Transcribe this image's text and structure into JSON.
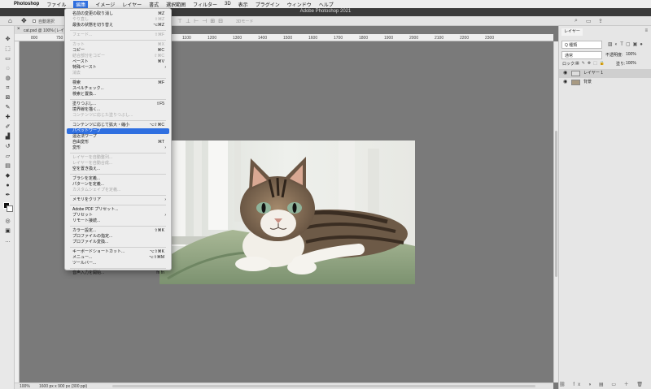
{
  "menubar": {
    "apple": "",
    "app": "Photoshop",
    "items": [
      "ファイル",
      "編集",
      "イメージ",
      "レイヤー",
      "書式",
      "選択範囲",
      "フィルター",
      "3D",
      "表示",
      "プラグイン",
      "ウィンドウ",
      "ヘルプ"
    ],
    "active_index": 1
  },
  "window": {
    "title": "Adobe Photoshop 2021"
  },
  "options": {
    "autoselect_label": "自動選択",
    "mode3d": "3Dモード"
  },
  "document": {
    "tab_label": "cat.psd @ 100% (レイヤー",
    "zoom": "100%",
    "info": "1600 px x 900 px (300 ppi)"
  },
  "ruler": {
    "ticks": [
      "800",
      "750",
      "700",
      "650",
      "900",
      "1000",
      "1100",
      "1200",
      "1300",
      "1400",
      "1500",
      "1600",
      "1700",
      "1800",
      "1900",
      "2000",
      "2100",
      "2200",
      "2300"
    ]
  },
  "edit_menu": {
    "items": [
      {
        "label": "名前の変更の取り消し",
        "shortcut": "⌘Z",
        "disabled": false
      },
      {
        "label": "やり直し",
        "shortcut": "⇧⌘Z",
        "disabled": true
      },
      {
        "label": "最後の状態を切り替え",
        "shortcut": "⌥⌘Z",
        "disabled": false
      },
      {
        "label": "フェード...",
        "shortcut": "⇧⌘F",
        "disabled": true
      },
      {
        "label": "カット",
        "shortcut": "⌘X",
        "disabled": true
      },
      {
        "label": "コピー",
        "shortcut": "⌘C",
        "disabled": false
      },
      {
        "label": "結合部分をコピー",
        "shortcut": "⇧⌘C",
        "disabled": true
      },
      {
        "label": "ペースト",
        "shortcut": "⌘V",
        "disabled": false
      },
      {
        "label": "特殊ペースト",
        "shortcut": "",
        "disabled": false,
        "submenu": true
      },
      {
        "label": "消去",
        "shortcut": "",
        "disabled": true
      },
      {
        "label": "検索",
        "shortcut": "⌘F",
        "disabled": false
      },
      {
        "label": "スペルチェック...",
        "shortcut": "",
        "disabled": false
      },
      {
        "label": "検索と置換...",
        "shortcut": "",
        "disabled": false
      },
      {
        "label": "塗りつぶし...",
        "shortcut": "⇧F5",
        "disabled": false
      },
      {
        "label": "境界線を描く...",
        "shortcut": "",
        "disabled": false
      },
      {
        "label": "コンテンツに応じた塗りつぶし...",
        "shortcut": "",
        "disabled": true
      },
      {
        "label": "コンテンツに応じて拡大・縮小",
        "shortcut": "⌥⇧⌘C",
        "disabled": false
      },
      {
        "label": "パペットワープ",
        "shortcut": "",
        "disabled": false,
        "highlighted": true
      },
      {
        "label": "遠近法ワープ",
        "shortcut": "",
        "disabled": false
      },
      {
        "label": "自由変形",
        "shortcut": "⌘T",
        "disabled": false
      },
      {
        "label": "変形",
        "shortcut": "",
        "disabled": false,
        "submenu": true
      },
      {
        "label": "レイヤーを自動整列...",
        "shortcut": "",
        "disabled": true
      },
      {
        "label": "レイヤーを自動合成...",
        "shortcut": "",
        "disabled": true
      },
      {
        "label": "空を置き換え...",
        "shortcut": "",
        "disabled": false
      },
      {
        "label": "ブラシを定義...",
        "shortcut": "",
        "disabled": false
      },
      {
        "label": "パターンを定義...",
        "shortcut": "",
        "disabled": false
      },
      {
        "label": "カスタムシェイプを定義...",
        "shortcut": "",
        "disabled": true
      },
      {
        "label": "メモリをクリア",
        "shortcut": "",
        "disabled": false,
        "submenu": true
      },
      {
        "label": "Adobe PDF プリセット...",
        "shortcut": "",
        "disabled": false
      },
      {
        "label": "プリセット",
        "shortcut": "",
        "disabled": false,
        "submenu": true
      },
      {
        "label": "リモート接続...",
        "shortcut": "",
        "disabled": false
      },
      {
        "label": "カラー設定...",
        "shortcut": "⇧⌘K",
        "disabled": false
      },
      {
        "label": "プロファイルの指定...",
        "shortcut": "",
        "disabled": false
      },
      {
        "label": "プロファイル変換...",
        "shortcut": "",
        "disabled": false
      },
      {
        "label": "キーボードショートカット...",
        "shortcut": "⌥⇧⌘K",
        "disabled": false
      },
      {
        "label": "メニュー...",
        "shortcut": "⌥⇧⌘M",
        "disabled": false
      },
      {
        "label": "ツールバー...",
        "shortcut": "",
        "disabled": false
      },
      {
        "label": "音声入力を開始...",
        "shortcut": "fn fn",
        "disabled": false
      }
    ]
  },
  "layers_panel": {
    "tab": "レイヤー",
    "kind_filter": "Q 種類",
    "blend_mode": "通常",
    "opacity_label": "不透明度:",
    "opacity_value": "100%",
    "lock_label": "ロック:",
    "fill_label": "塗り:",
    "fill_value": "100%",
    "layers": [
      {
        "name": "レイヤー 1",
        "active": true
      },
      {
        "name": "背景",
        "active": false
      }
    ]
  },
  "colors": {
    "accent": "#2f6fe0",
    "canvas_bg": "#7a7a7a",
    "chrome": "#e3e3e3"
  }
}
